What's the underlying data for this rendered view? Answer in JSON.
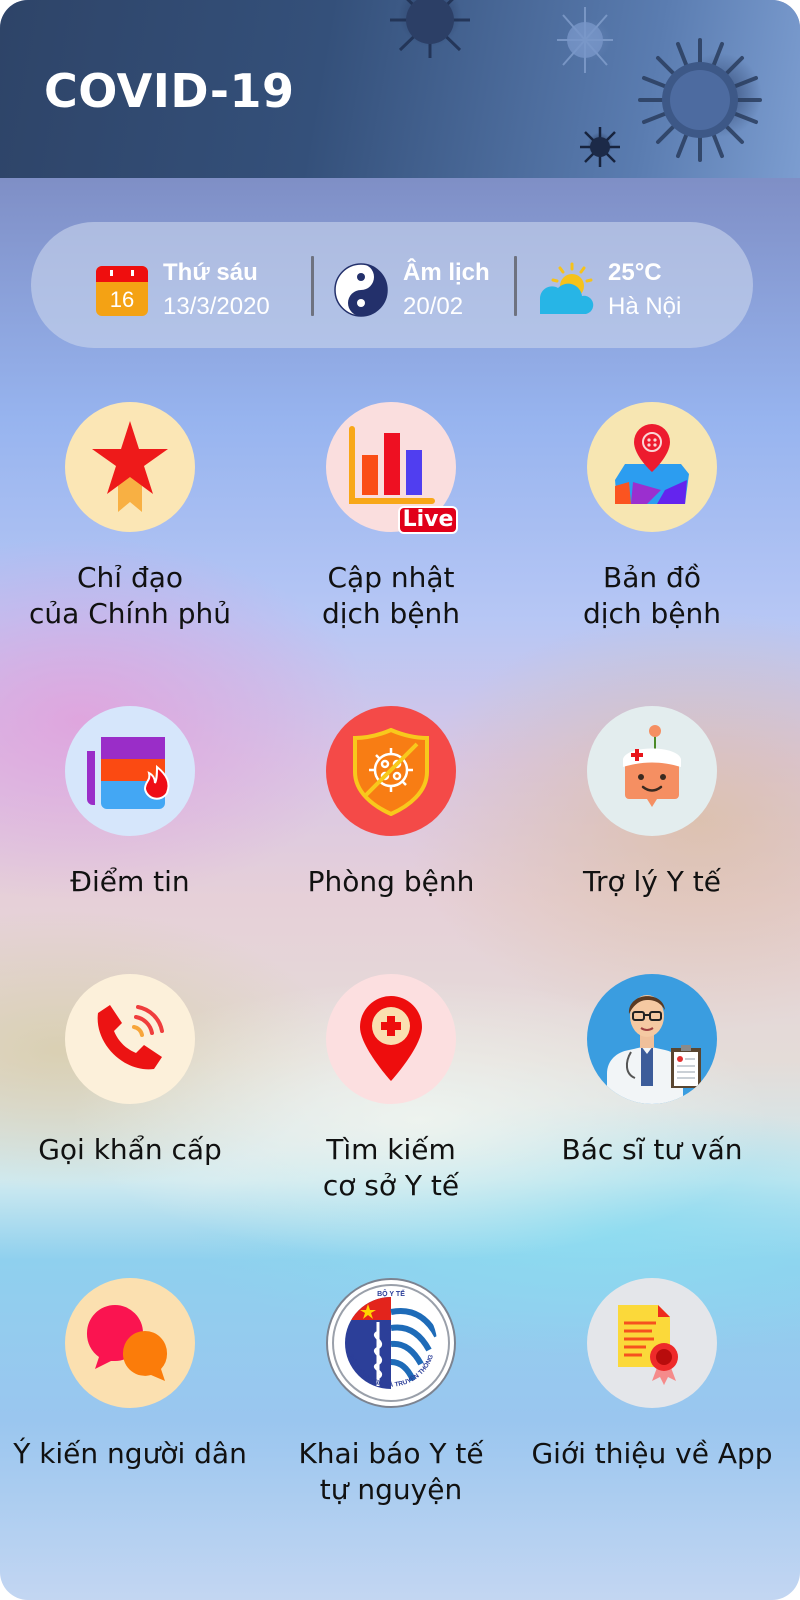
{
  "header": {
    "title": "COVID-19"
  },
  "info_bar": {
    "date": {
      "icon": "calendar-icon",
      "calendar_day": "16",
      "weekday": "Thứ sáu",
      "date": "13/3/2020"
    },
    "lunar": {
      "icon": "yin-yang-icon",
      "label": "Âm lịch",
      "date": "20/02"
    },
    "weather": {
      "icon": "partly-cloudy-icon",
      "temperature": "25°C",
      "location": "Hà Nội"
    }
  },
  "menu": [
    {
      "id": "government-directive",
      "icon": "star-ribbon-icon",
      "lines": [
        "Chỉ đạo",
        "của Chính phủ"
      ],
      "bg": "#fbe6b5"
    },
    {
      "id": "epidemic-update",
      "icon": "bar-chart-icon",
      "badge": "Live",
      "lines": [
        "Cập nhật",
        "dịch bệnh"
      ],
      "bg": "#fadede"
    },
    {
      "id": "epidemic-map",
      "icon": "map-pin-virus-icon",
      "lines": [
        "Bản đồ",
        "dịch bệnh"
      ],
      "bg": "#f7e6b2"
    },
    {
      "id": "news-brief",
      "icon": "newspaper-fire-icon",
      "lines": [
        "Điểm tin"
      ],
      "bg": "#d6e6fb"
    },
    {
      "id": "prevention",
      "icon": "virus-shield-icon",
      "lines": [
        "Phòng bệnh"
      ],
      "bg": "#f44a48"
    },
    {
      "id": "medical-assistant",
      "icon": "nurse-bot-icon",
      "lines": [
        "Trợ lý Y tế"
      ],
      "bg": "#e3edee"
    },
    {
      "id": "emergency-call",
      "icon": "phone-ringing-icon",
      "lines": [
        "Gọi khẩn cấp"
      ],
      "bg": "#fcf0da"
    },
    {
      "id": "find-medical-facility",
      "icon": "medical-location-pin-icon",
      "lines": [
        "Tìm kiếm",
        "cơ sở Y tế"
      ],
      "bg": "#fcdfe0"
    },
    {
      "id": "doctor-consult",
      "icon": "doctor-icon",
      "lines": [
        "Bác sĩ tư vấn"
      ],
      "bg": "#3a9de0"
    },
    {
      "id": "citizen-feedback",
      "icon": "chat-bubbles-icon",
      "lines": [
        "Ý kiến người dân"
      ],
      "bg": "#fbe0b0"
    },
    {
      "id": "health-declaration",
      "icon": "ministry-logo-icon",
      "logo_top": "BỘ Y TẾ",
      "logo_bottom": "BỘ THÔNG TIN VÀ TRUYỀN THÔNG",
      "lines": [
        "Khai báo Y tế",
        "tự nguyện"
      ],
      "bg": "#ffffff"
    },
    {
      "id": "about-app",
      "icon": "certificate-icon",
      "lines": [
        "Giới thiệu về App"
      ],
      "bg": "#e4e6ea"
    }
  ]
}
